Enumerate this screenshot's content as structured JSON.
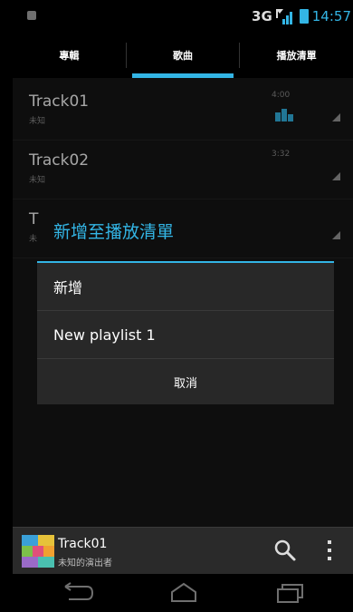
{
  "status_bar": {
    "network": "3G",
    "time": "14:57"
  },
  "tabs": [
    {
      "label": "專輯"
    },
    {
      "label": "歌曲"
    },
    {
      "label": "播放清單"
    }
  ],
  "tracks": [
    {
      "title": "Track01",
      "artist": "未知",
      "duration": "4:00"
    },
    {
      "title": "Track02",
      "artist": "未知",
      "duration": "3:32"
    },
    {
      "title": "T",
      "artist": "未"
    }
  ],
  "dialog": {
    "title": "新增至播放清單",
    "items": [
      "新增",
      "New playlist 1"
    ],
    "cancel": "取消"
  },
  "now_playing": {
    "title": "Track01",
    "artist": "未知的演出者"
  },
  "colors": {
    "accent": "#33b5e5",
    "background": "#161616"
  }
}
